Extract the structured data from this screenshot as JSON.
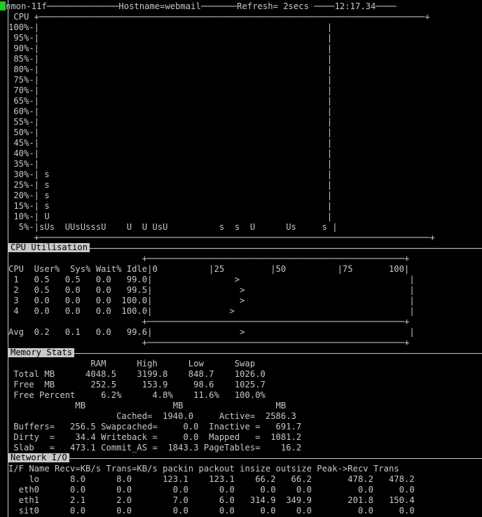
{
  "title_line": "nmon-11f──────────────Hostname=webmail───────Refresh= 2secs ────12:17.34────",
  "cpu_graph": [
    " CPU +───────────────────────────────────────────────────────────────────────────+",
    "100%-|                                                        |",
    " 95%-|                                                        |",
    " 90%-|                                                        |",
    " 85%-|                                                        |",
    " 80%-|                                                        |",
    " 75%-|                                                        |",
    " 70%-|                                                        |",
    " 65%-|                                                        |",
    " 60%-|                                                        |",
    " 55%-|                                                        |",
    " 50%-|                                                        |",
    " 45%-|                                                        |",
    " 40%-|                                                        |",
    " 35%-|                                                        |",
    " 30%-| s                                                      |",
    " 25%-| s                                                      |",
    " 20%-| s                                                      |",
    " 15%-| s                                                      |",
    " 10%-| U                                                      |",
    "  5%-|sUs  UUsUsssU    U  U UsU          s  s  U      Us     s |",
    "     +────────────────────────────────────────────────────────────────────────────+"
  ],
  "cpu_util": {
    "section_label": "CPU Utilisation",
    "lines": [
      "                          +──────────────────────────────────────────────────+",
      "CPU  User%  Sys% Wait% Idle|0          |25         |50          |75       100|",
      " 1   0.5   0.5   0.0   99.0|                >                                 |",
      " 2   0.5   0.0   0.0   99.5|                 >                                |",
      " 3   0.0   0.0   0.0  100.0|                 >                                |",
      " 4   0.0   0.0   0.0  100.0|               >                                  |",
      "                          +──────────────────────────────────────────────────+",
      "Avg  0.2   0.1   0.0   99.6|                 >                                |",
      "                          +──────────────────────────────────────────────────+"
    ]
  },
  "memory": {
    "section_label": "Memory Stats",
    "lines": [
      "                RAM      High      Low      Swap",
      " Total MB      4048.5    3199.8    848.7    1026.0",
      " Free  MB       252.5     153.9     98.6    1025.7",
      " Free Percent     6.2%      4.8%    11.6%   100.0%",
      "             MB                 MB                  MB",
      "                     Cached=  1940.0     Active=  2586.3",
      " Buffers=   256.5 Swapcached=     0.0  Inactive =   691.7",
      " Dirty  =    34.4 Writeback =     0.0  Mapped   =  1081.2",
      " Slab   =   473.1 Commit_AS =  1843.3 PageTables=    16.2"
    ]
  },
  "network": {
    "section_label": "Network I/O",
    "lines": [
      "I/F Name Recv=KB/s Trans=KB/s packin packout insize outsize Peak->Recv Trans",
      "    lo      8.0      8.0      123.1    123.1    66.2   66.2       478.2   478.2",
      "  eth0      0.0      0.0        0.0      0.0     0.0    0.0         0.0     0.0",
      "  eth1      2.1      2.0        7.0      6.0   314.9  349.9       201.8   150.4",
      "  sit0      0.0      0.0        0.0      0.0     0.0    0.0         0.0     0.0"
    ]
  }
}
